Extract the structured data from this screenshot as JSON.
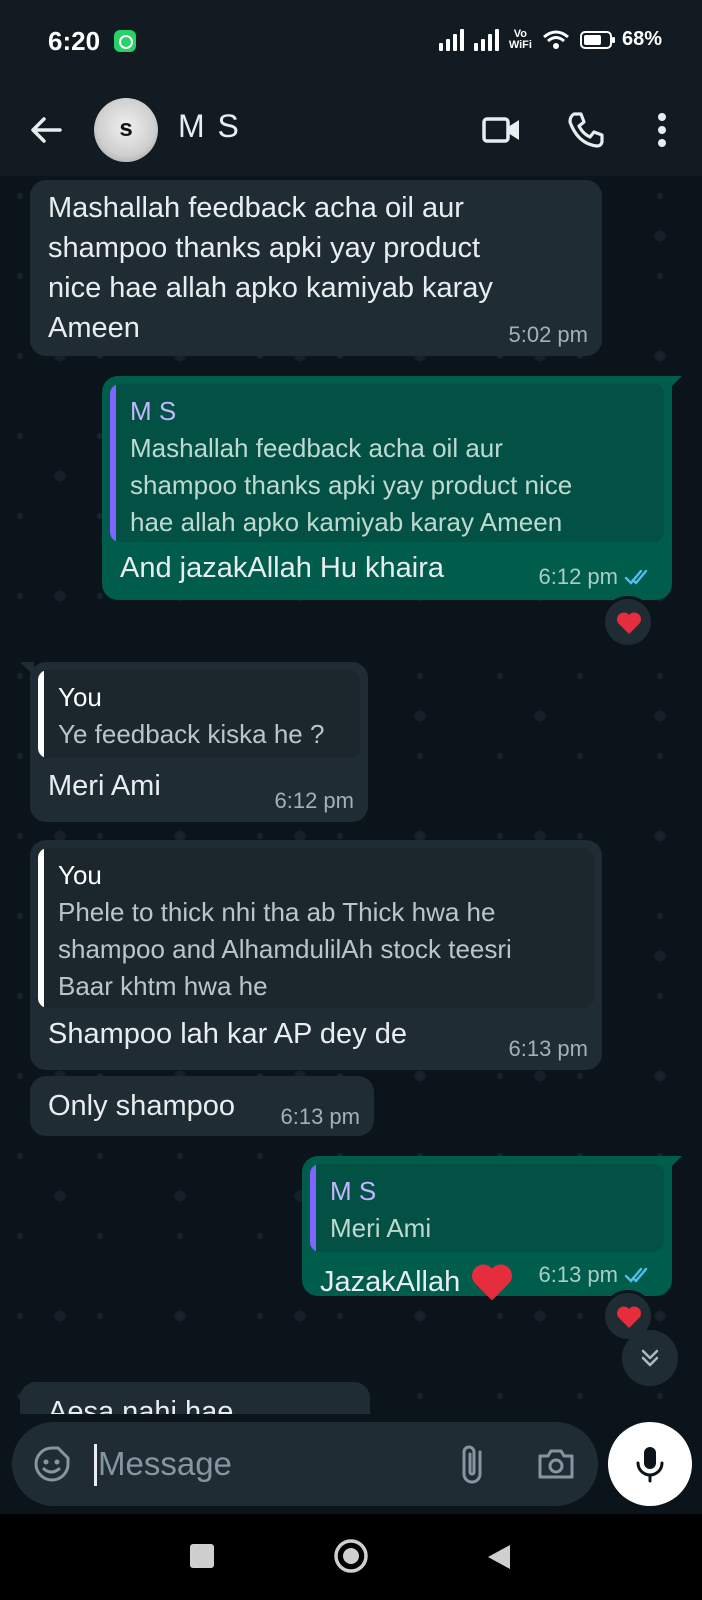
{
  "status_bar": {
    "time": "6:20",
    "network_label_top": "Vo",
    "network_label_bottom": "WiFi",
    "battery": "68%"
  },
  "header": {
    "contact_name": "M S",
    "avatar_initial": "s"
  },
  "messages": [
    {
      "direction": "incoming",
      "text_lines": [
        "Mashallah feedback acha oil aur",
        "shampoo thanks apki yay product",
        "nice hae allah apko kamiyab karay",
        "Ameen"
      ],
      "time": "5:02 pm"
    },
    {
      "direction": "outgoing",
      "quote": {
        "author": "M S",
        "text_lines": [
          "Mashallah feedback acha oil aur",
          "shampoo thanks apki yay product nice",
          "hae allah apko kamiyab karay Ameen"
        ]
      },
      "text": "And jazakAllah Hu khaira",
      "time": "6:12 pm",
      "ticks": "read",
      "reaction": "heart"
    },
    {
      "direction": "incoming",
      "quote": {
        "author": "You",
        "text_lines": [
          "Ye feedback kiska he ?"
        ]
      },
      "text": "Meri Ami",
      "time": "6:12 pm"
    },
    {
      "direction": "incoming",
      "quote": {
        "author": "You",
        "text_lines": [
          "Phele to thick nhi tha ab Thick hwa he",
          "shampoo and AlhamdulilAh stock teesri",
          "Baar khtm hwa he"
        ]
      },
      "text": "Shampoo lah kar AP dey de",
      "time": "6:13 pm"
    },
    {
      "direction": "incoming",
      "text": "Only shampoo",
      "time": "6:13 pm"
    },
    {
      "direction": "outgoing",
      "quote": {
        "author": "M S",
        "text_lines": [
          "Meri Ami"
        ]
      },
      "text": "JazakAllah",
      "time": "6:13 pm",
      "ticks": "read",
      "reaction": "heart"
    },
    {
      "direction": "incoming",
      "text": "Aesa nahi hae",
      "partial": true
    }
  ],
  "composer": {
    "placeholder": "Message"
  },
  "colors": {
    "incoming_bubble": "#202c33",
    "outgoing_bubble": "#005c4b",
    "quote_author_you": "#ffffff",
    "quote_author_ms": "#7f66ff",
    "read_ticks": "#53bdeb",
    "heart": "#e52d3e"
  },
  "icons": [
    "back-arrow-icon",
    "video-call-icon",
    "voice-call-icon",
    "more-options-icon",
    "emoji-sticker-icon",
    "attachment-icon",
    "camera-icon",
    "mic-icon",
    "scroll-down-icon"
  ]
}
